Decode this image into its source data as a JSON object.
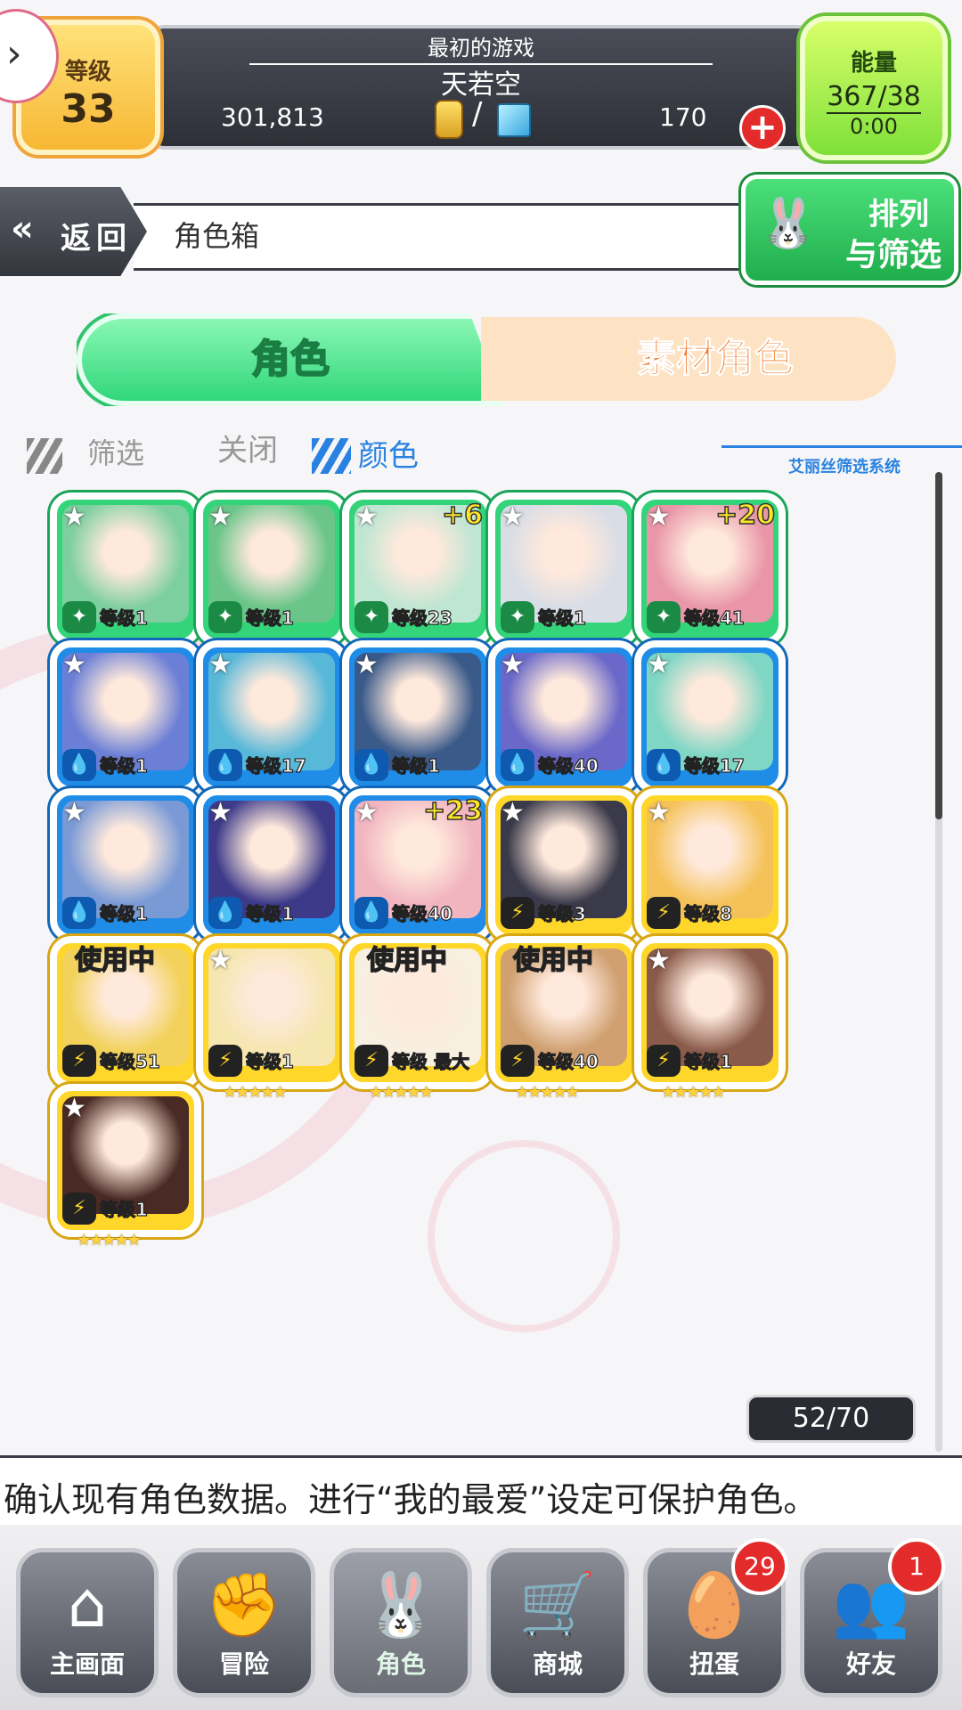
{
  "top": {
    "level_label": "等级",
    "level_value": "33",
    "subtitle": "最初的游戏",
    "player_name": "天若空",
    "gold": "301,813",
    "separator": "/",
    "gems": "170",
    "plus": "+",
    "energy_label": "能量",
    "energy_value": "367/38",
    "energy_timer": "0:00"
  },
  "header": {
    "back_label": "返回",
    "back_icon": "«",
    "breadcrumb": "角色箱",
    "sort_label_line1": "排列",
    "sort_label_line2": "与筛选"
  },
  "tabs": {
    "characters": "角色",
    "materials": "素材角色"
  },
  "filter": {
    "filter_label": "筛选",
    "state_label": "关闭",
    "color_label": "颜色",
    "system_label": "艾丽丝筛选系统"
  },
  "cards": [
    {
      "color": "g",
      "level": "等级1",
      "plus": "",
      "in_use": "",
      "stars": "★★★★★★"
    },
    {
      "color": "g",
      "level": "等级1",
      "plus": "",
      "in_use": "",
      "stars": "★★★★★"
    },
    {
      "color": "g",
      "level": "等级23",
      "plus": "+6",
      "in_use": "",
      "stars": "★★★★★"
    },
    {
      "color": "g",
      "level": "等级1",
      "plus": "",
      "in_use": "",
      "stars": "★★★★★★"
    },
    {
      "color": "g",
      "level": "等级41",
      "plus": "+20",
      "in_use": "",
      "stars": "★★★★★"
    },
    {
      "color": "b",
      "level": "等级1",
      "plus": "",
      "in_use": "",
      "stars": "★★★★"
    },
    {
      "color": "b",
      "level": "等级17",
      "plus": "",
      "in_use": "",
      "stars": "★★★★★"
    },
    {
      "color": "b",
      "level": "等级1",
      "plus": "",
      "in_use": "",
      "stars": "★★★★★"
    },
    {
      "color": "b",
      "level": "等级40",
      "plus": "",
      "in_use": "",
      "stars": "★★★★★"
    },
    {
      "color": "b",
      "level": "等级17",
      "plus": "",
      "in_use": "",
      "stars": "★★★★"
    },
    {
      "color": "b",
      "level": "等级1",
      "plus": "",
      "in_use": "",
      "stars": "★★★★★"
    },
    {
      "color": "b",
      "level": "等级1",
      "plus": "",
      "in_use": "",
      "stars": "★★★★★"
    },
    {
      "color": "b",
      "level": "等级40",
      "plus": "+23",
      "in_use": "",
      "stars": "★★★★★"
    },
    {
      "color": "y",
      "level": "等级3",
      "plus": "",
      "in_use": "",
      "stars": "★★★★★"
    },
    {
      "color": "y",
      "level": "等级8",
      "plus": "",
      "in_use": "",
      "stars": "★★★★★"
    },
    {
      "color": "y",
      "level": "等级51",
      "plus": "",
      "in_use": "使用中",
      "stars": "★★★★★"
    },
    {
      "color": "y",
      "level": "等级1",
      "plus": "",
      "in_use": "",
      "stars": "★★★★★"
    },
    {
      "color": "y",
      "level": "等级 最大",
      "plus": "",
      "in_use": "使用中",
      "stars": "★★★★★"
    },
    {
      "color": "y",
      "level": "等级40",
      "plus": "",
      "in_use": "使用中",
      "stars": "★★★★★"
    },
    {
      "color": "y",
      "level": "等级1",
      "plus": "",
      "in_use": "",
      "stars": "★★★★★"
    },
    {
      "color": "y",
      "level": "等级1",
      "plus": "",
      "in_use": "",
      "stars": "★★★★★"
    }
  ],
  "counter": "52/70",
  "hint": "确认现有角色数据。进行“我的最爱”设定可保护角色。",
  "nav": [
    {
      "label": "主画面",
      "icon": "home-icon",
      "badge": ""
    },
    {
      "label": "冒险",
      "icon": "handshake-icon",
      "badge": ""
    },
    {
      "label": "角色",
      "icon": "rabbit-icon",
      "badge": ""
    },
    {
      "label": "商城",
      "icon": "cart-icon",
      "badge": ""
    },
    {
      "label": "扭蛋",
      "icon": "egg-icon",
      "badge": "29"
    },
    {
      "label": "好友",
      "icon": "friends-icon",
      "badge": "1"
    }
  ]
}
